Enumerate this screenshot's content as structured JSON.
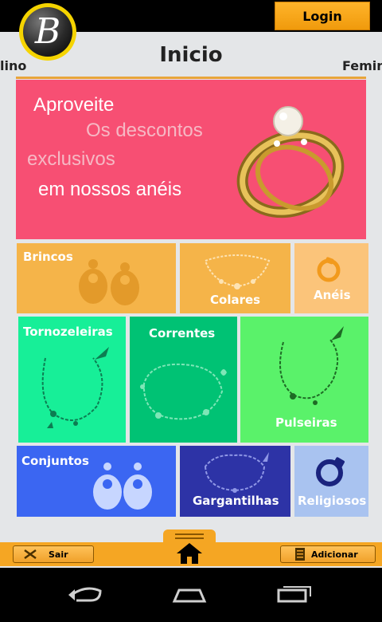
{
  "topbar": {
    "login_label": "Login"
  },
  "logo": {
    "letter": "B"
  },
  "header": {
    "title": "Inicio",
    "nav_left": "lino",
    "nav_right": "Femini"
  },
  "promo": {
    "line1": "Aproveite",
    "line2": "Os descontos",
    "line3": "exclusivos",
    "line4": "em nossos anéis"
  },
  "categories": {
    "brincos": "Brincos",
    "colares": "Colares",
    "aneis": "Anéis",
    "tornozeleiras": "Tornozeleiras",
    "correntes": "Correntes",
    "pulseiras": "Pulseiras",
    "conjuntos": "Conjuntos",
    "gargantilhas": "Gargantilhas",
    "religiosos": "Religiosos"
  },
  "footer": {
    "sair_label": "Sair",
    "adicionar_label": "Adicionar"
  },
  "icons": [
    "close-x-icon",
    "home-icon",
    "list-icon",
    "back-icon",
    "home-nav-icon",
    "recents-icon"
  ],
  "colors": {
    "accent": "#f5a623",
    "promo": "#f74f73",
    "brincos": "#f5b449",
    "colares": "#f5b449",
    "aneis": "#fbc47a",
    "tornozeleiras": "#17ef98",
    "correntes": "#00c274",
    "pulseiras": "#5af26a",
    "conjuntos": "#3b66f2",
    "gargantilhas": "#2d33a6",
    "religiosos": "#a9c3f0"
  }
}
